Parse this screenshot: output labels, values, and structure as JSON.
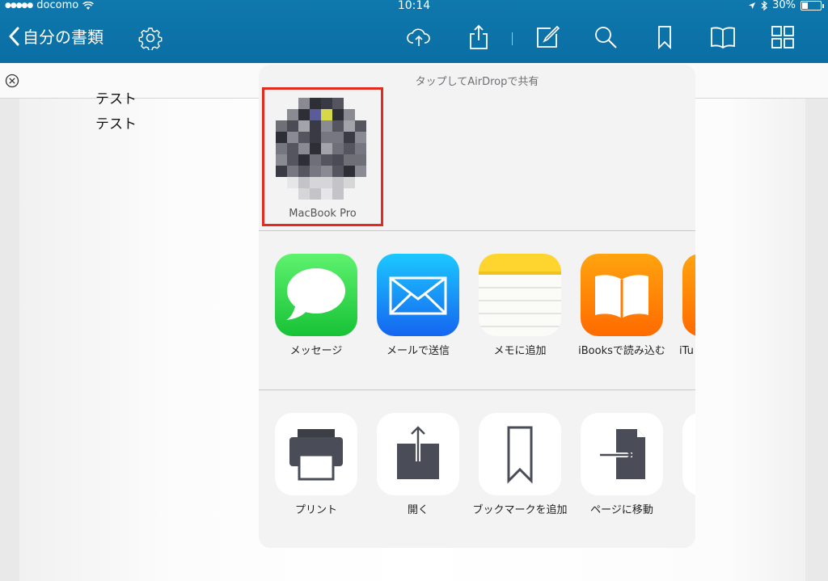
{
  "status_bar": {
    "carrier": "docomo",
    "time": "10:14",
    "battery": "30%"
  },
  "toolbar": {
    "back_label": "自分の書類"
  },
  "document": {
    "lines": [
      "テスト",
      "テスト"
    ]
  },
  "share_sheet": {
    "title": "タップしてAirDropで共有",
    "airdrop_device": "MacBook Pro",
    "apps": [
      {
        "label": "メッセージ",
        "icon": "messages-icon"
      },
      {
        "label": "メールで送信",
        "icon": "mail-icon"
      },
      {
        "label": "メモに追加",
        "icon": "notes-icon"
      },
      {
        "label": "iBooksで読み込む",
        "icon": "ibooks-icon"
      },
      {
        "label": "iTu",
        "icon": "itunes-icon"
      }
    ],
    "actions": [
      {
        "label": "プリント",
        "icon": "printer-icon"
      },
      {
        "label": "開く",
        "icon": "open-in-icon"
      },
      {
        "label": "ブックマークを追加",
        "icon": "bookmark-icon"
      },
      {
        "label": "ページに移動",
        "icon": "go-to-page-icon"
      }
    ]
  },
  "colors": {
    "toolbar": "#0c73a8",
    "highlight": "#e22a1f",
    "messages": "#34c759",
    "mail": "#1a8cff",
    "ibooks": "#ff8a00"
  }
}
